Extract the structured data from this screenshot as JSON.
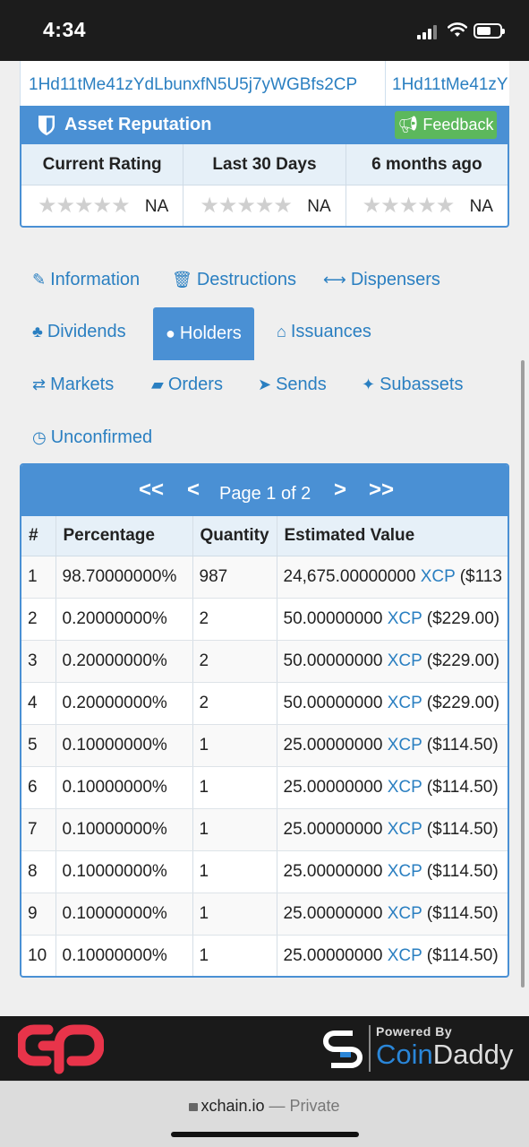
{
  "status": {
    "time": "4:34"
  },
  "address_row": [
    "1Hd11tMe41zYdLbunxfN5U5j7yWGBfs2CP",
    "1Hd11tMe41zY"
  ],
  "reputation": {
    "title": "Asset Reputation",
    "feedback_label": "Feedback",
    "columns": [
      "Current Rating",
      "Last 30 Days",
      "6 months ago"
    ],
    "values": [
      "NA",
      "NA",
      "NA"
    ],
    "stars_glyph": "★★★★★"
  },
  "tabs": [
    {
      "label": "Information",
      "icon": "paperclip-icon",
      "glyph": "✎"
    },
    {
      "label": "Destructions",
      "icon": "trash-icon",
      "glyph": "🗑"
    },
    {
      "label": "Dispensers",
      "icon": "arrows-h-icon",
      "glyph": "⟷"
    },
    {
      "label": "Dividends",
      "icon": "sitemap-icon",
      "glyph": "♣"
    },
    {
      "label": "Holders",
      "icon": "user-icon",
      "glyph": "●",
      "active": true
    },
    {
      "label": "Issuances",
      "icon": "bank-icon",
      "glyph": "⌂"
    },
    {
      "label": "Markets",
      "icon": "exchange-icon",
      "glyph": "⇄"
    },
    {
      "label": "Orders",
      "icon": "book-icon",
      "glyph": "▰"
    },
    {
      "label": "Sends",
      "icon": "paper-plane-icon",
      "glyph": "➤"
    },
    {
      "label": "Subassets",
      "icon": "child-icon",
      "glyph": "✦"
    },
    {
      "label": "Unconfirmed",
      "icon": "clock-icon",
      "glyph": "◷"
    }
  ],
  "pager": {
    "first": "<<",
    "prev": "<",
    "label": "Page 1 of 2",
    "next": ">",
    "last": ">>"
  },
  "holders": {
    "columns": [
      "#",
      "Percentage",
      "Quantity",
      "Estimated Value"
    ],
    "rows": [
      {
        "n": "1",
        "pct": "98.70000000%",
        "qty": "987",
        "val": "24,675.00000000",
        "unit": "XCP",
        "usd": "($113"
      },
      {
        "n": "2",
        "pct": "0.20000000%",
        "qty": "2",
        "val": "50.00000000",
        "unit": "XCP",
        "usd": "($229.00)"
      },
      {
        "n": "3",
        "pct": "0.20000000%",
        "qty": "2",
        "val": "50.00000000",
        "unit": "XCP",
        "usd": "($229.00)"
      },
      {
        "n": "4",
        "pct": "0.20000000%",
        "qty": "2",
        "val": "50.00000000",
        "unit": "XCP",
        "usd": "($229.00)"
      },
      {
        "n": "5",
        "pct": "0.10000000%",
        "qty": "1",
        "val": "25.00000000",
        "unit": "XCP",
        "usd": "($114.50)"
      },
      {
        "n": "6",
        "pct": "0.10000000%",
        "qty": "1",
        "val": "25.00000000",
        "unit": "XCP",
        "usd": "($114.50)"
      },
      {
        "n": "7",
        "pct": "0.10000000%",
        "qty": "1",
        "val": "25.00000000",
        "unit": "XCP",
        "usd": "($114.50)"
      },
      {
        "n": "8",
        "pct": "0.10000000%",
        "qty": "1",
        "val": "25.00000000",
        "unit": "XCP",
        "usd": "($114.50)"
      },
      {
        "n": "9",
        "pct": "0.10000000%",
        "qty": "1",
        "val": "25.00000000",
        "unit": "XCP",
        "usd": "($114.50)"
      },
      {
        "n": "10",
        "pct": "0.10000000%",
        "qty": "1",
        "val": "25.00000000",
        "unit": "XCP",
        "usd": "($114.50)"
      }
    ]
  },
  "footer": {
    "powered_by": "Powered By",
    "brand_coin": "Coin",
    "brand_daddy": "Daddy"
  },
  "browser": {
    "domain": "xchain.io",
    "suffix": "— Private"
  },
  "colors": {
    "primary": "#4a90d4",
    "link": "#2a7fc1",
    "feedback": "#5cb85c",
    "counterparty": "#e8344a",
    "coindaddy": "#2a86d8"
  }
}
